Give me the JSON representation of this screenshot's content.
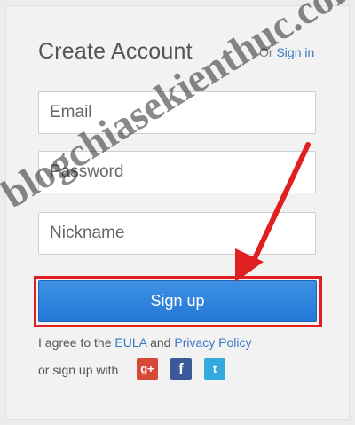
{
  "header": {
    "title": "Create Account",
    "signin_prefix": "Or",
    "signin_link": "Sign in"
  },
  "form": {
    "email_placeholder": "Email",
    "password_placeholder": "Password",
    "nickname_placeholder": "Nickname",
    "submit_label": "Sign up"
  },
  "legal": {
    "prefix": "I agree to the",
    "eula": "EULA",
    "and": "and",
    "privacy": "Privacy Policy"
  },
  "social": {
    "label": "or sign up with",
    "icons": [
      "google-plus-icon",
      "facebook-icon",
      "twitter-icon"
    ],
    "gplus_glyph": "g+",
    "fb_glyph": "f",
    "tw_glyph": "t"
  },
  "watermark": "blogchiasekienthuc.com",
  "colors": {
    "button": "#2a7fd9",
    "highlight": "#e02020",
    "link": "#3a78c3"
  }
}
